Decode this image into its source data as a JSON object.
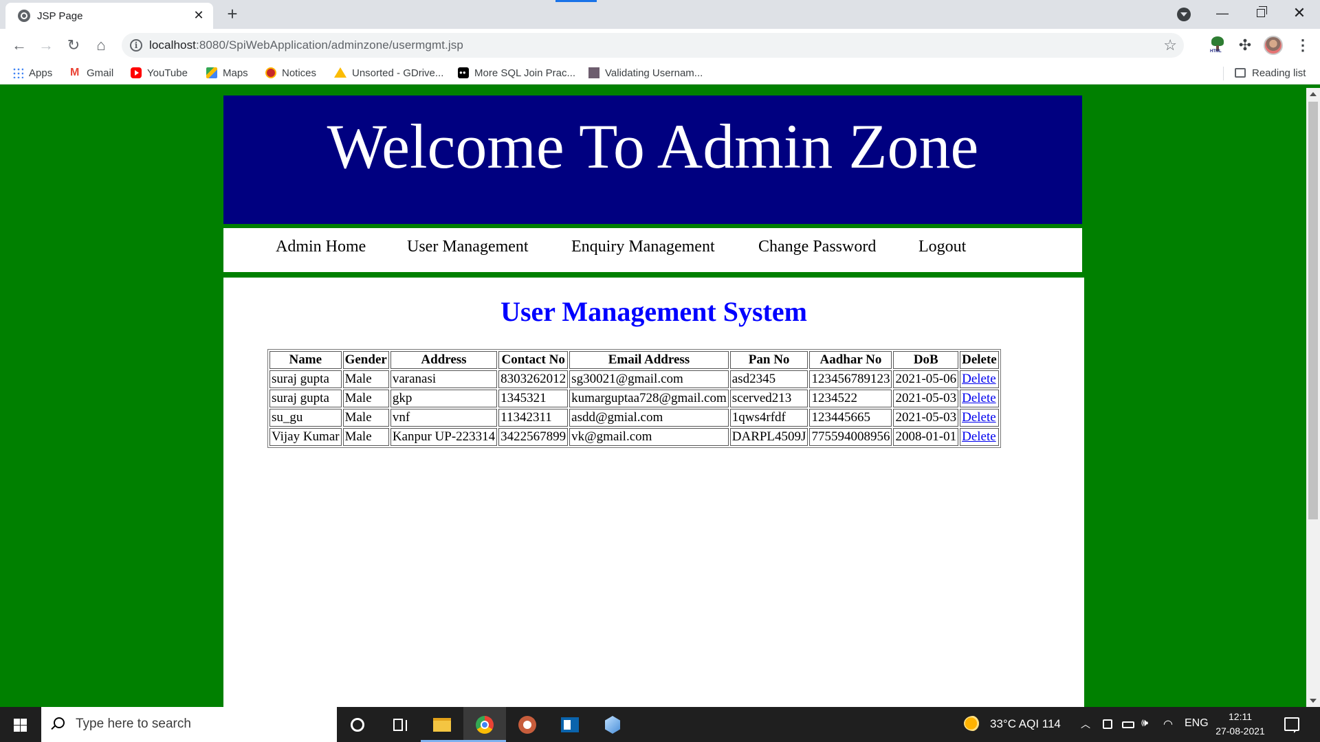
{
  "browser": {
    "tab_title": "JSP Page",
    "url_host": "localhost",
    "url_rest": ":8080/SpiWebApplication/adminzone/usermgmt.jsp",
    "bookmarks": [
      {
        "label": "Apps",
        "icon": "apps-grid-icon"
      },
      {
        "label": "Gmail",
        "icon": "gmail-icon"
      },
      {
        "label": "YouTube",
        "icon": "youtube-icon"
      },
      {
        "label": "Maps",
        "icon": "maps-icon"
      },
      {
        "label": "Notices",
        "icon": "notices-icon"
      },
      {
        "label": "Unsorted - GDrive...",
        "icon": "google-drive-icon"
      },
      {
        "label": "More SQL Join Prac...",
        "icon": "medium-icon"
      },
      {
        "label": "Validating Usernam...",
        "icon": "page-icon"
      }
    ],
    "reading_list": "Reading list"
  },
  "page": {
    "header_title": "Welcome To Admin Zone",
    "nav": [
      "Admin Home",
      "User Management",
      "Enquiry Management",
      "Change Password",
      "Logout"
    ],
    "section_title": "User Management System",
    "table": {
      "headers": [
        "Name",
        "Gender",
        "Address",
        "Contact No",
        "Email Address",
        "Pan No",
        "Aadhar No",
        "DoB",
        "Delete"
      ],
      "rows": [
        [
          "suraj gupta",
          "Male",
          "varanasi",
          "8303262012",
          "sg30021@gmail.com",
          "asd2345",
          "123456789123",
          "2021-05-06",
          "Delete"
        ],
        [
          "suraj gupta",
          "Male",
          "gkp",
          "1345321",
          "kumarguptaa728@gmail.com",
          "scerved213",
          "1234522",
          "2021-05-03",
          "Delete"
        ],
        [
          "su_gu",
          "Male",
          "vnf",
          "11342311",
          "asdd@gmial.com",
          "1qws4rfdf",
          "123445665",
          "2021-05-03",
          "Delete"
        ],
        [
          "Vijay Kumar",
          "Male",
          "Kanpur UP-223314",
          "3422567899",
          "vk@gmail.com",
          "DARPL4509J",
          "775594008956",
          "2008-01-01",
          "Delete"
        ]
      ]
    },
    "colors": {
      "background": "#008000",
      "header_band": "#000080",
      "section_title": "#0000ff",
      "link": "#0000ee"
    }
  },
  "taskbar": {
    "search_placeholder": "Type here to search",
    "weather": "33°C  AQI 114",
    "language": "ENG",
    "time": "12:11",
    "date": "27-08-2021"
  }
}
